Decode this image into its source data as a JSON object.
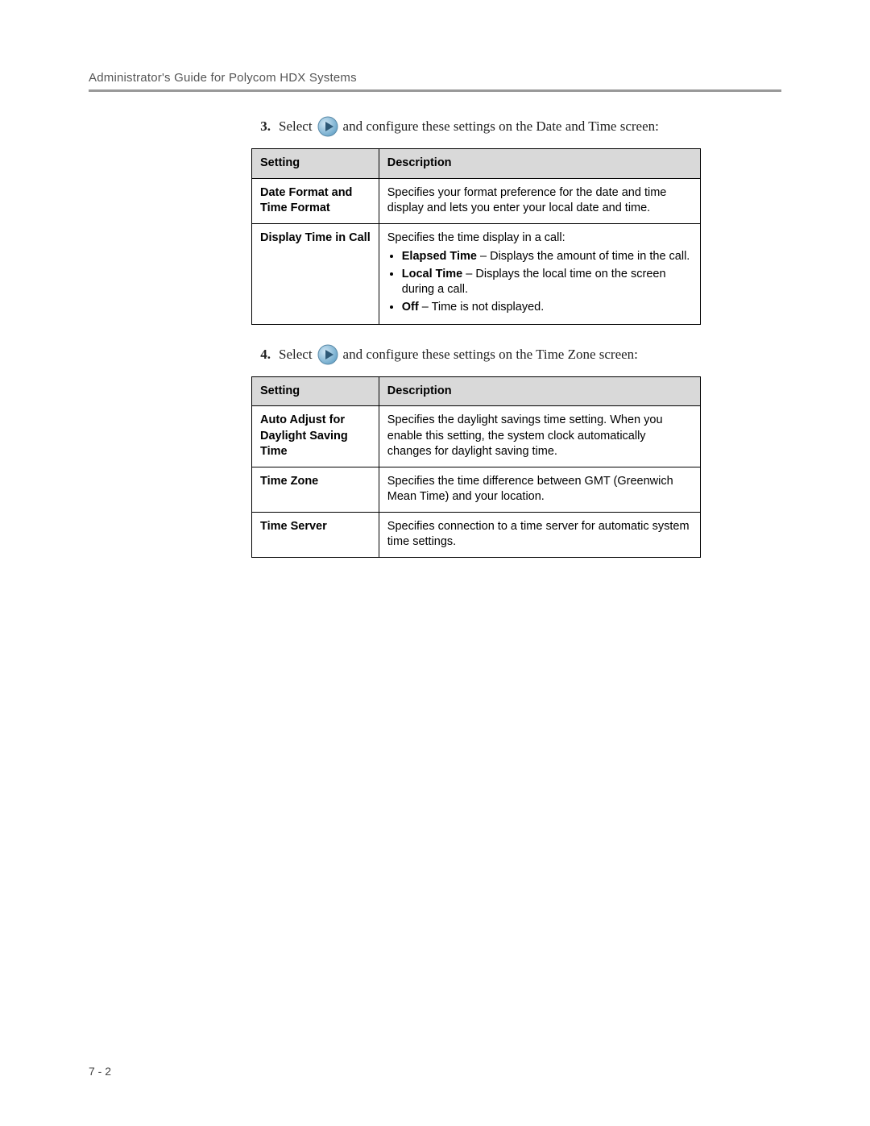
{
  "header": {
    "title": "Administrator's Guide for Polycom HDX Systems"
  },
  "steps": [
    {
      "number": "3.",
      "before": "Select",
      "after": "and configure these settings on the Date and Time screen:",
      "table": {
        "col1": "Setting",
        "col2": "Description",
        "rows": [
          {
            "setting": "Date Format and Time Format",
            "desc_intro": "Specifies your format preference for the date and time display and lets you enter your local date and time.",
            "bullets": []
          },
          {
            "setting": "Display Time in Call",
            "desc_intro": "Specifies the time display in a call:",
            "bullets": [
              {
                "bold": "Elapsed Time",
                "rest": " – Displays the amount of time in the call."
              },
              {
                "bold": "Local Time",
                "rest": " – Displays the local time on the screen during a call."
              },
              {
                "bold": "Off",
                "rest": " – Time is not displayed."
              }
            ]
          }
        ]
      }
    },
    {
      "number": "4.",
      "before": "Select",
      "after": "and configure these settings on the Time Zone screen:",
      "table": {
        "col1": "Setting",
        "col2": "Description",
        "rows": [
          {
            "setting": "Auto Adjust for Daylight Saving Time",
            "desc_intro": "Specifies the daylight savings time setting. When you enable this setting, the system clock automatically changes for daylight saving time.",
            "bullets": []
          },
          {
            "setting": "Time Zone",
            "desc_intro": "Specifies the time difference between GMT (Greenwich Mean Time) and your location.",
            "bullets": []
          },
          {
            "setting": "Time Server",
            "desc_intro": "Specifies connection to a time server for automatic system time settings.",
            "bullets": []
          }
        ]
      }
    }
  ],
  "page_number": "7 - 2"
}
